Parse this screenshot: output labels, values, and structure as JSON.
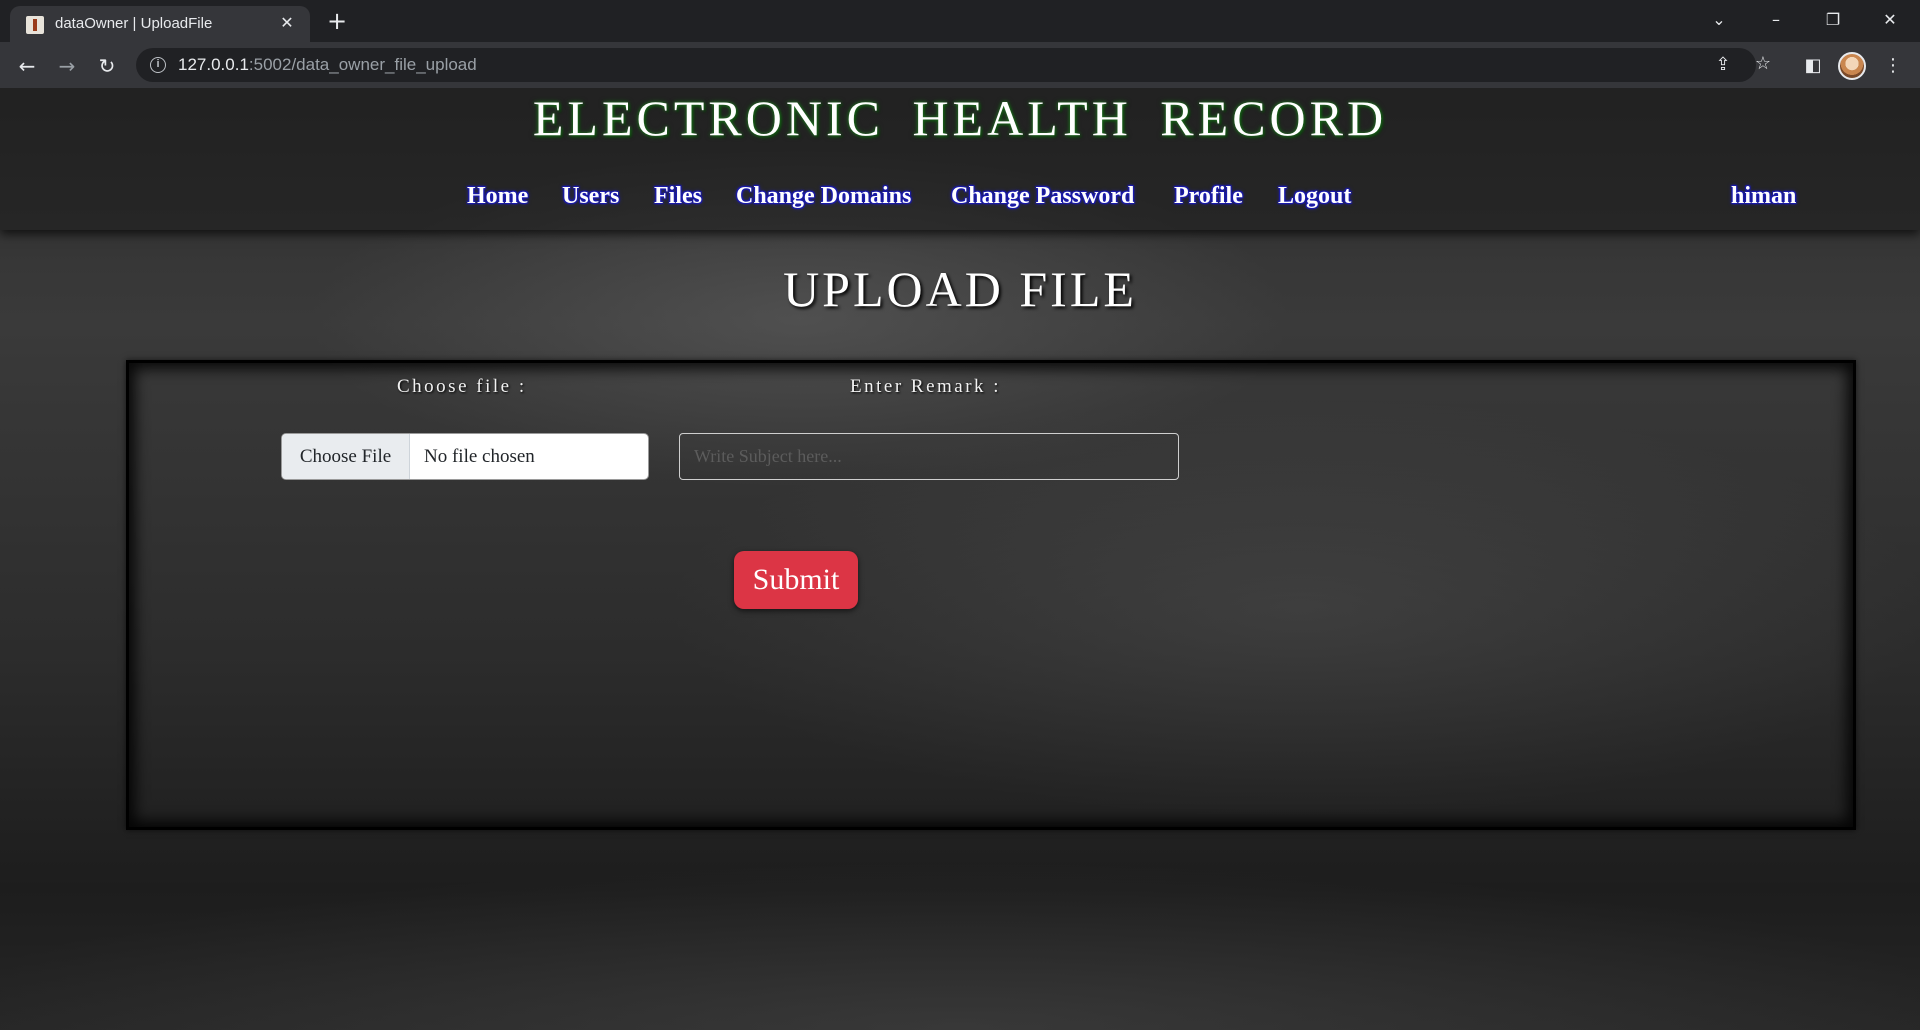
{
  "browser": {
    "tab_title": "dataOwner | UploadFile",
    "url_host": "127.0.0.1",
    "url_rest": ":5002/data_owner_file_upload"
  },
  "site": {
    "title": "ELECTRONIC HEALTH RECORD",
    "nav": {
      "home": "Home",
      "users": "Users",
      "files": "Files",
      "change_domains": "Change Domains",
      "change_password": "Change Password",
      "profile": "Profile",
      "logout": "Logout"
    },
    "username": "himan"
  },
  "upload": {
    "page_title": "UPLOAD FILE",
    "choose_file_label": "Choose file :",
    "choose_file_button": "Choose File",
    "file_status": "No file chosen",
    "remark_label": "Enter Remark :",
    "remark_value": "",
    "remark_placeholder": "Write Subject here...",
    "submit_label": "Submit"
  },
  "colors": {
    "submit_bg": "#dc3545",
    "nav_glow": "#1a1ab0",
    "title_glow": "#2a7a2a"
  }
}
